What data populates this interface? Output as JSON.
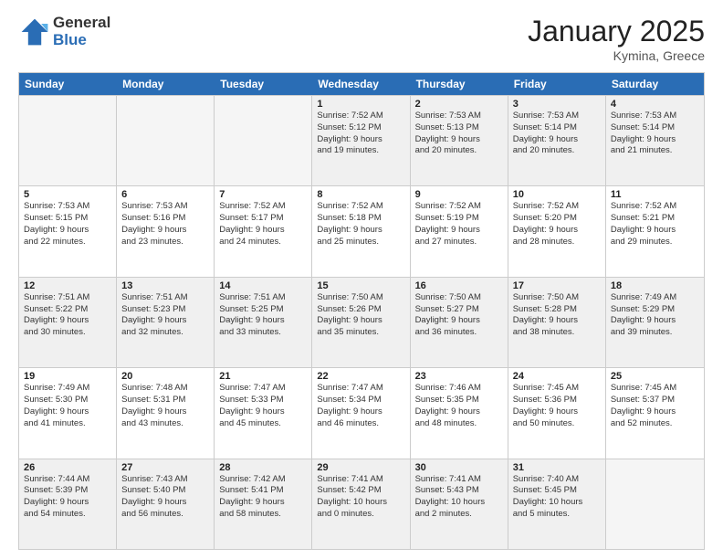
{
  "header": {
    "logo_general": "General",
    "logo_blue": "Blue",
    "month": "January 2025",
    "location": "Kymina, Greece"
  },
  "weekdays": [
    "Sunday",
    "Monday",
    "Tuesday",
    "Wednesday",
    "Thursday",
    "Friday",
    "Saturday"
  ],
  "weeks": [
    [
      {
        "day": "",
        "content": "",
        "empty": true
      },
      {
        "day": "",
        "content": "",
        "empty": true
      },
      {
        "day": "",
        "content": "",
        "empty": true
      },
      {
        "day": "1",
        "content": "Sunrise: 7:52 AM\nSunset: 5:12 PM\nDaylight: 9 hours\nand 19 minutes."
      },
      {
        "day": "2",
        "content": "Sunrise: 7:53 AM\nSunset: 5:13 PM\nDaylight: 9 hours\nand 20 minutes."
      },
      {
        "day": "3",
        "content": "Sunrise: 7:53 AM\nSunset: 5:14 PM\nDaylight: 9 hours\nand 20 minutes."
      },
      {
        "day": "4",
        "content": "Sunrise: 7:53 AM\nSunset: 5:14 PM\nDaylight: 9 hours\nand 21 minutes."
      }
    ],
    [
      {
        "day": "5",
        "content": "Sunrise: 7:53 AM\nSunset: 5:15 PM\nDaylight: 9 hours\nand 22 minutes."
      },
      {
        "day": "6",
        "content": "Sunrise: 7:53 AM\nSunset: 5:16 PM\nDaylight: 9 hours\nand 23 minutes."
      },
      {
        "day": "7",
        "content": "Sunrise: 7:52 AM\nSunset: 5:17 PM\nDaylight: 9 hours\nand 24 minutes."
      },
      {
        "day": "8",
        "content": "Sunrise: 7:52 AM\nSunset: 5:18 PM\nDaylight: 9 hours\nand 25 minutes."
      },
      {
        "day": "9",
        "content": "Sunrise: 7:52 AM\nSunset: 5:19 PM\nDaylight: 9 hours\nand 27 minutes."
      },
      {
        "day": "10",
        "content": "Sunrise: 7:52 AM\nSunset: 5:20 PM\nDaylight: 9 hours\nand 28 minutes."
      },
      {
        "day": "11",
        "content": "Sunrise: 7:52 AM\nSunset: 5:21 PM\nDaylight: 9 hours\nand 29 minutes."
      }
    ],
    [
      {
        "day": "12",
        "content": "Sunrise: 7:51 AM\nSunset: 5:22 PM\nDaylight: 9 hours\nand 30 minutes."
      },
      {
        "day": "13",
        "content": "Sunrise: 7:51 AM\nSunset: 5:23 PM\nDaylight: 9 hours\nand 32 minutes."
      },
      {
        "day": "14",
        "content": "Sunrise: 7:51 AM\nSunset: 5:25 PM\nDaylight: 9 hours\nand 33 minutes."
      },
      {
        "day": "15",
        "content": "Sunrise: 7:50 AM\nSunset: 5:26 PM\nDaylight: 9 hours\nand 35 minutes."
      },
      {
        "day": "16",
        "content": "Sunrise: 7:50 AM\nSunset: 5:27 PM\nDaylight: 9 hours\nand 36 minutes."
      },
      {
        "day": "17",
        "content": "Sunrise: 7:50 AM\nSunset: 5:28 PM\nDaylight: 9 hours\nand 38 minutes."
      },
      {
        "day": "18",
        "content": "Sunrise: 7:49 AM\nSunset: 5:29 PM\nDaylight: 9 hours\nand 39 minutes."
      }
    ],
    [
      {
        "day": "19",
        "content": "Sunrise: 7:49 AM\nSunset: 5:30 PM\nDaylight: 9 hours\nand 41 minutes."
      },
      {
        "day": "20",
        "content": "Sunrise: 7:48 AM\nSunset: 5:31 PM\nDaylight: 9 hours\nand 43 minutes."
      },
      {
        "day": "21",
        "content": "Sunrise: 7:47 AM\nSunset: 5:33 PM\nDaylight: 9 hours\nand 45 minutes."
      },
      {
        "day": "22",
        "content": "Sunrise: 7:47 AM\nSunset: 5:34 PM\nDaylight: 9 hours\nand 46 minutes."
      },
      {
        "day": "23",
        "content": "Sunrise: 7:46 AM\nSunset: 5:35 PM\nDaylight: 9 hours\nand 48 minutes."
      },
      {
        "day": "24",
        "content": "Sunrise: 7:45 AM\nSunset: 5:36 PM\nDaylight: 9 hours\nand 50 minutes."
      },
      {
        "day": "25",
        "content": "Sunrise: 7:45 AM\nSunset: 5:37 PM\nDaylight: 9 hours\nand 52 minutes."
      }
    ],
    [
      {
        "day": "26",
        "content": "Sunrise: 7:44 AM\nSunset: 5:39 PM\nDaylight: 9 hours\nand 54 minutes."
      },
      {
        "day": "27",
        "content": "Sunrise: 7:43 AM\nSunset: 5:40 PM\nDaylight: 9 hours\nand 56 minutes."
      },
      {
        "day": "28",
        "content": "Sunrise: 7:42 AM\nSunset: 5:41 PM\nDaylight: 9 hours\nand 58 minutes."
      },
      {
        "day": "29",
        "content": "Sunrise: 7:41 AM\nSunset: 5:42 PM\nDaylight: 10 hours\nand 0 minutes."
      },
      {
        "day": "30",
        "content": "Sunrise: 7:41 AM\nSunset: 5:43 PM\nDaylight: 10 hours\nand 2 minutes."
      },
      {
        "day": "31",
        "content": "Sunrise: 7:40 AM\nSunset: 5:45 PM\nDaylight: 10 hours\nand 5 minutes."
      },
      {
        "day": "",
        "content": "",
        "empty": true
      }
    ]
  ]
}
